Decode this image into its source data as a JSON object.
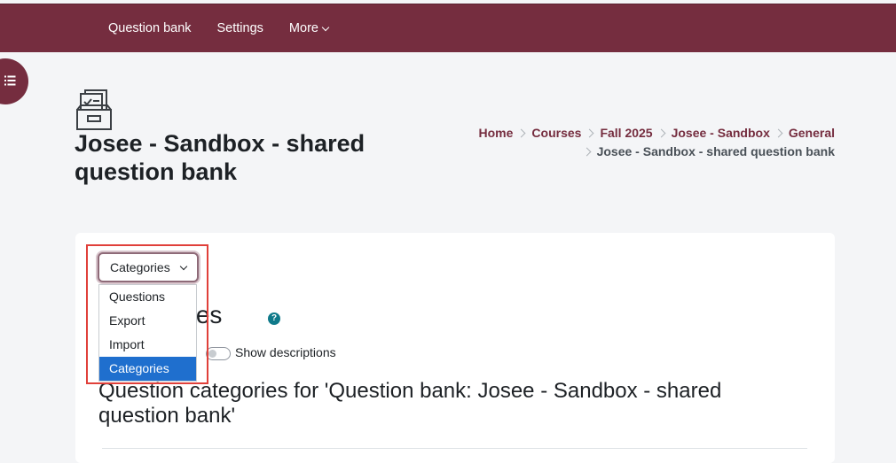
{
  "topnav": {
    "items": [
      "Question bank",
      "Settings"
    ],
    "more_label": "More"
  },
  "page": {
    "title": "Josee - Sandbox - shared question bank"
  },
  "breadcrumb": {
    "items": [
      "Home",
      "Courses",
      "Fall 2025",
      "Josee - Sandbox",
      "General"
    ],
    "current": "Josee - Sandbox - shared question bank"
  },
  "main": {
    "heading": "Categories",
    "help_symbol": "?",
    "toggle_label": "Show descriptions",
    "toggle_on": false,
    "categories_heading": "Question categories for 'Question bank: Josee - Sandbox - shared question bank'"
  },
  "select": {
    "selected": "Categories",
    "options": [
      "Questions",
      "Export",
      "Import",
      "Categories"
    ]
  },
  "colors": {
    "brand": "#752d3f",
    "highlight": "#e0403a",
    "selected_option": "#1f6fce",
    "help": "#0f7a8a"
  }
}
